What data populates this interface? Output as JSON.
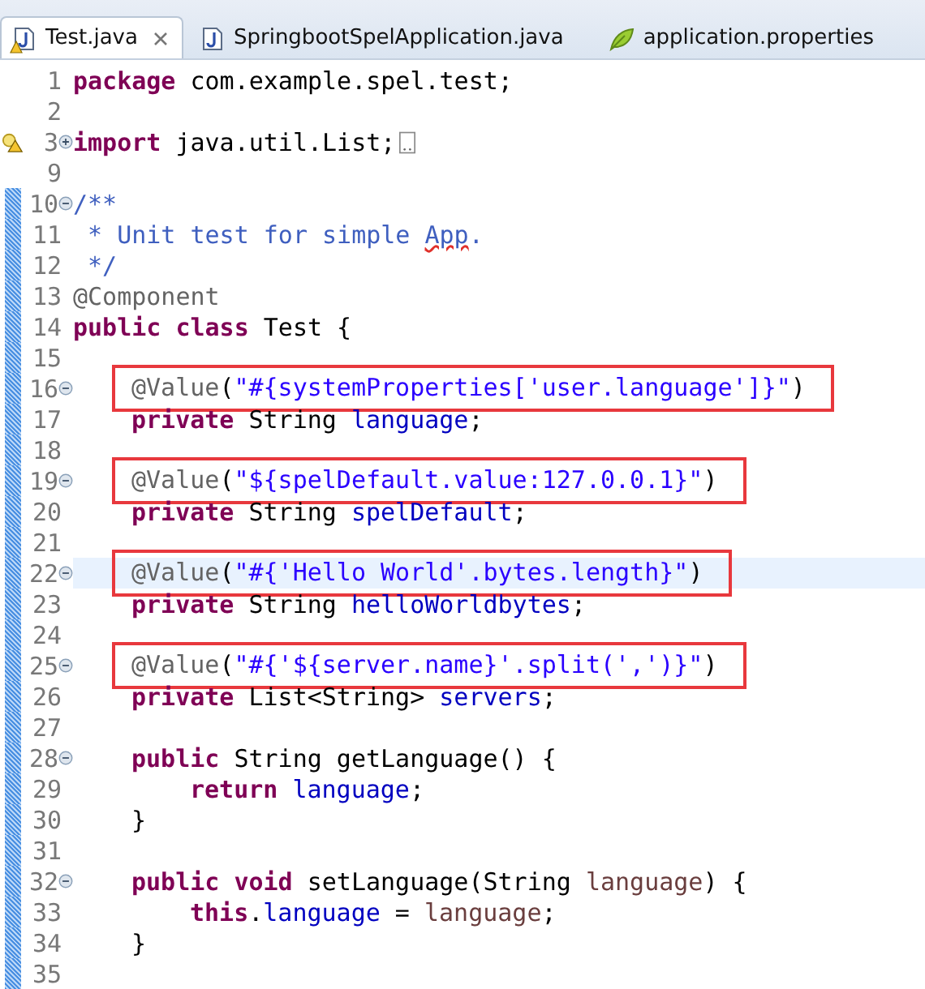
{
  "tabs": [
    {
      "label": "Test.java",
      "kind": "java",
      "selected": true,
      "warning": true
    },
    {
      "label": "SpringbootSpelApplication.java",
      "kind": "java",
      "selected": false
    },
    {
      "label": "application.properties",
      "kind": "properties",
      "selected": false
    }
  ],
  "lines": [
    {
      "number": "1",
      "tokens": [
        {
          "kind": "keyword",
          "text": "package"
        },
        {
          "kind": "plain",
          "text": " com.example.spel.test;"
        }
      ]
    },
    {
      "number": "2"
    },
    {
      "number": "3",
      "expandable": true,
      "warning": true,
      "folded": true,
      "tokens": [
        {
          "kind": "keyword",
          "text": "import"
        },
        {
          "kind": "plain",
          "text": " java.util.List;"
        }
      ]
    },
    {
      "number": "9"
    },
    {
      "number": "10",
      "collapsible": true,
      "ruler": true,
      "tokens": [
        {
          "kind": "comment",
          "text": "/**"
        }
      ]
    },
    {
      "number": "11",
      "ruler": true,
      "tokens": [
        {
          "kind": "comment",
          "text": " * Unit test for simple "
        },
        {
          "kind": "misspelled",
          "text": "App"
        },
        {
          "kind": "comment",
          "text": "."
        }
      ]
    },
    {
      "number": "12",
      "ruler": true,
      "tokens": [
        {
          "kind": "comment",
          "text": " */"
        }
      ]
    },
    {
      "number": "13",
      "ruler": true,
      "tokens": [
        {
          "kind": "annotation",
          "text": "@Component"
        }
      ]
    },
    {
      "number": "14",
      "ruler": true,
      "tokens": [
        {
          "kind": "keyword",
          "text": "public"
        },
        {
          "kind": "keyword",
          "text": " class"
        },
        {
          "kind": "plain",
          "text": " Test {"
        }
      ]
    },
    {
      "number": "15",
      "ruler": true
    },
    {
      "number": "16",
      "collapsible": true,
      "ruler": true,
      "boxed": true,
      "kind": "member",
      "tokens": [
        {
          "kind": "annotation",
          "text": "@Value"
        },
        {
          "kind": "plain",
          "text": "("
        },
        {
          "kind": "string",
          "text": "\"#{systemProperties['user.language']}\""
        },
        {
          "kind": "plain",
          "text": ")"
        }
      ]
    },
    {
      "number": "17",
      "ruler": true,
      "kind": "member",
      "tokens": [
        {
          "kind": "keyword",
          "text": "private"
        },
        {
          "kind": "plain",
          "text": " String "
        },
        {
          "kind": "field",
          "text": "language"
        },
        {
          "kind": "plain",
          "text": ";"
        }
      ]
    },
    {
      "number": "18",
      "ruler": true
    },
    {
      "number": "19",
      "collapsible": true,
      "ruler": true,
      "boxed": true,
      "kind": "member",
      "tokens": [
        {
          "kind": "annotation",
          "text": "@Value"
        },
        {
          "kind": "plain",
          "text": "("
        },
        {
          "kind": "string",
          "text": "\"${spelDefault.value:127.0.0.1}\""
        },
        {
          "kind": "plain",
          "text": ")"
        }
      ]
    },
    {
      "number": "20",
      "ruler": true,
      "kind": "member",
      "tokens": [
        {
          "kind": "keyword",
          "text": "private"
        },
        {
          "kind": "plain",
          "text": " String "
        },
        {
          "kind": "field",
          "text": "spelDefault"
        },
        {
          "kind": "plain",
          "text": ";"
        }
      ]
    },
    {
      "number": "21",
      "ruler": true
    },
    {
      "number": "22",
      "collapsible": true,
      "ruler": true,
      "boxed": true,
      "current": true,
      "kind": "member",
      "tokens": [
        {
          "kind": "annotation",
          "text": "@Value"
        },
        {
          "kind": "plain",
          "text": "("
        },
        {
          "kind": "string",
          "text": "\"#{'Hello World'.bytes.length}\""
        },
        {
          "kind": "plain",
          "text": ")"
        }
      ]
    },
    {
      "number": "23",
      "ruler": true,
      "kind": "member",
      "tokens": [
        {
          "kind": "keyword",
          "text": "private"
        },
        {
          "kind": "plain",
          "text": " String "
        },
        {
          "kind": "field",
          "text": "helloWorldbytes"
        },
        {
          "kind": "plain",
          "text": ";"
        }
      ]
    },
    {
      "number": "24",
      "ruler": true
    },
    {
      "number": "25",
      "collapsible": true,
      "ruler": true,
      "boxed": true,
      "kind": "member",
      "tokens": [
        {
          "kind": "annotation",
          "text": "@Value"
        },
        {
          "kind": "plain",
          "text": "("
        },
        {
          "kind": "string",
          "text": "\"#{'${server.name}'.split(',')}\""
        },
        {
          "kind": "plain",
          "text": ")"
        }
      ]
    },
    {
      "number": "26",
      "ruler": true,
      "kind": "member",
      "tokens": [
        {
          "kind": "keyword",
          "text": "private"
        },
        {
          "kind": "plain",
          "text": " List<String> "
        },
        {
          "kind": "field",
          "text": "servers"
        },
        {
          "kind": "plain",
          "text": ";"
        }
      ]
    },
    {
      "number": "27",
      "ruler": true
    },
    {
      "number": "28",
      "collapsible": true,
      "ruler": true,
      "kind": "member",
      "tokens": [
        {
          "kind": "keyword",
          "text": "public"
        },
        {
          "kind": "plain",
          "text": " String getLanguage() {"
        }
      ]
    },
    {
      "number": "29",
      "ruler": true,
      "kind": "body",
      "tokens": [
        {
          "kind": "keyword",
          "text": "return"
        },
        {
          "kind": "field",
          "text": " language"
        },
        {
          "kind": "plain",
          "text": ";"
        }
      ]
    },
    {
      "number": "30",
      "ruler": true,
      "kind": "member",
      "tokens": [
        {
          "kind": "plain",
          "text": "}"
        }
      ]
    },
    {
      "number": "31",
      "ruler": true
    },
    {
      "number": "32",
      "collapsible": true,
      "ruler": true,
      "kind": "member",
      "tokens": [
        {
          "kind": "keyword",
          "text": "public"
        },
        {
          "kind": "keyword",
          "text": " void"
        },
        {
          "kind": "plain",
          "text": " setLanguage(String "
        },
        {
          "kind": "param",
          "text": "language"
        },
        {
          "kind": "plain",
          "text": ") {"
        }
      ]
    },
    {
      "number": "33",
      "ruler": true,
      "kind": "body",
      "tokens": [
        {
          "kind": "keyword",
          "text": "this"
        },
        {
          "kind": "plain",
          "text": "."
        },
        {
          "kind": "field",
          "text": "language"
        },
        {
          "kind": "plain",
          "text": " = "
        },
        {
          "kind": "param",
          "text": "language"
        },
        {
          "kind": "plain",
          "text": ";"
        }
      ]
    },
    {
      "number": "34",
      "ruler": true,
      "kind": "member",
      "tokens": [
        {
          "kind": "plain",
          "text": "}"
        }
      ]
    },
    {
      "number": "35",
      "ruler": true
    }
  ]
}
